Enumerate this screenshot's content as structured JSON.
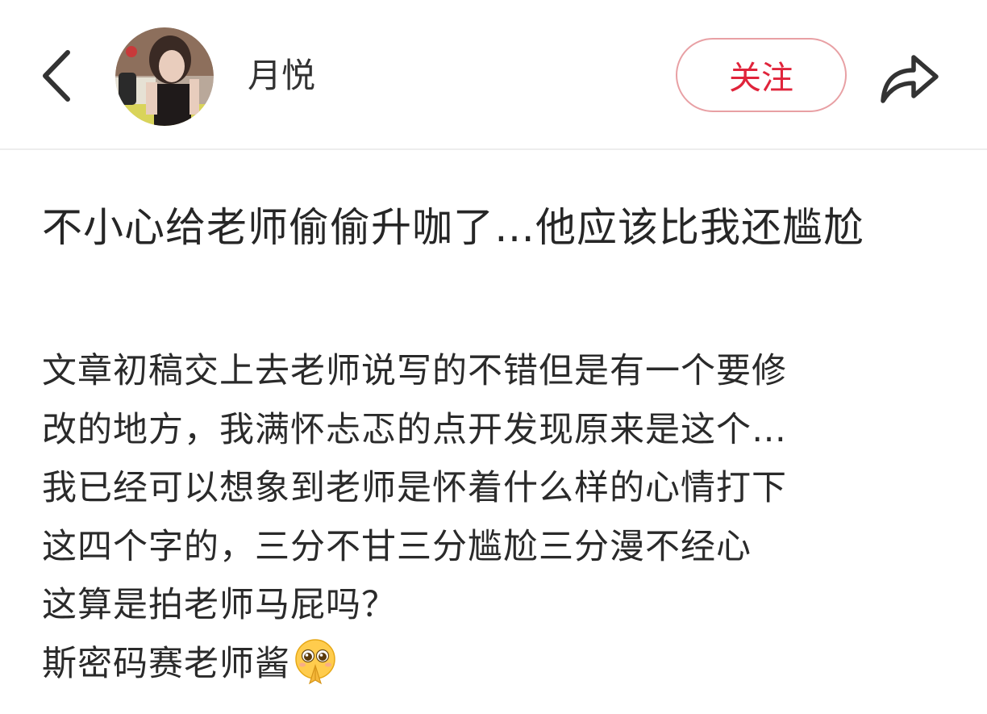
{
  "header": {
    "author_name": "月悦",
    "follow_label": "关注",
    "icons": {
      "back": "chevron-left-icon",
      "share": "share-arrow-icon"
    },
    "accent_color": "#e0243b"
  },
  "post": {
    "title": "不小心给老师偷偷升咖了…他应该比我还尴尬",
    "body_lines": [
      "文章初稿交上去老师说写的不错但是有一个要修",
      "改的地方，我满怀忐忑的点开发现原来是这个…",
      "我已经可以想象到老师是怀着什么样的心情打下",
      "这四个字的，三分不甘三分尴尬三分漫不经心",
      "这算是拍老师马屁吗？",
      "斯密码赛老师酱"
    ],
    "trailing_emoji": "pleading-hands-emoji"
  }
}
